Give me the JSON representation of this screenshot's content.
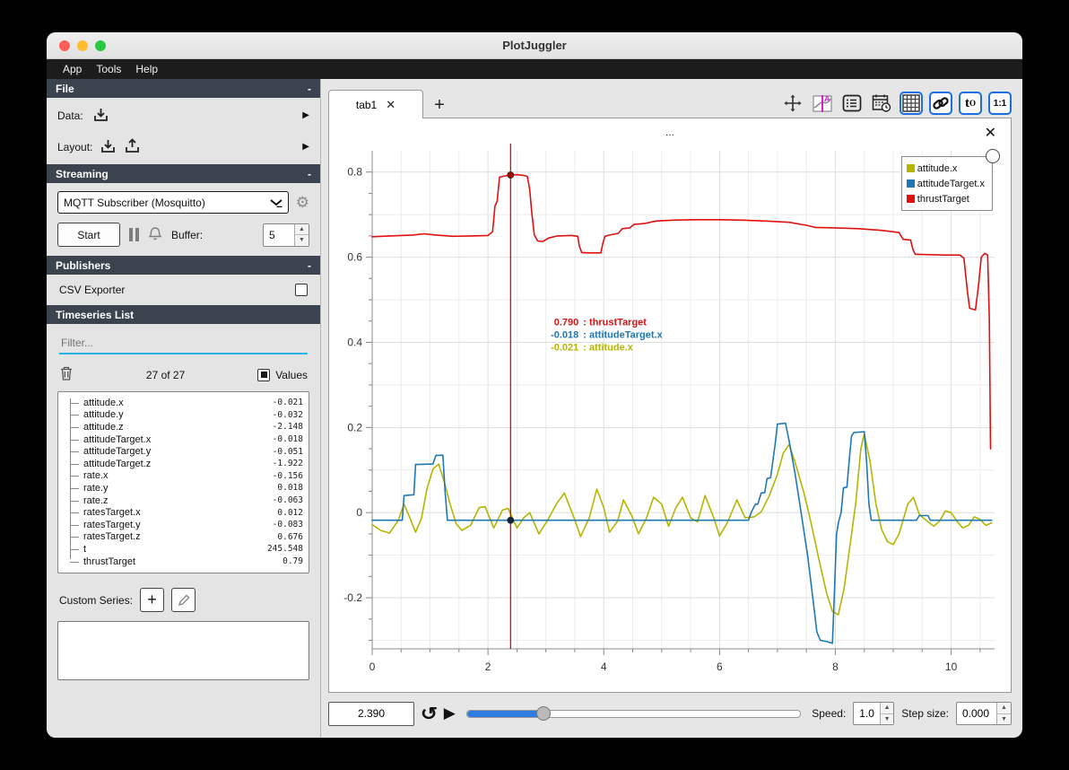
{
  "window": {
    "title": "PlotJuggler"
  },
  "menubar": {
    "items": [
      "App",
      "Tools",
      "Help"
    ]
  },
  "sidebar": {
    "file_section": {
      "title": "File",
      "collapse": "-",
      "data_label": "Data:",
      "layout_label": "Layout:"
    },
    "streaming_section": {
      "title": "Streaming",
      "collapse": "-",
      "source_selected": "MQTT Subscriber (Mosquitto)",
      "start_button": "Start",
      "buffer_label": "Buffer:",
      "buffer_value": "5"
    },
    "publishers_section": {
      "title": "Publishers",
      "collapse": "-",
      "csv_exporter_label": "CSV Exporter",
      "csv_exporter_checked": false
    },
    "timeseries_section": {
      "title": "Timeseries List",
      "filter_placeholder": "Filter...",
      "count_text": "27 of 27",
      "values_label": "Values",
      "items": [
        {
          "name": "attitude.x",
          "value": "-0.021"
        },
        {
          "name": "attitude.y",
          "value": "-0.032"
        },
        {
          "name": "attitude.z",
          "value": "-2.148"
        },
        {
          "name": "attitudeTarget.x",
          "value": "-0.018"
        },
        {
          "name": "attitudeTarget.y",
          "value": "-0.051"
        },
        {
          "name": "attitudeTarget.z",
          "value": "-1.922"
        },
        {
          "name": "rate.x",
          "value": "-0.156"
        },
        {
          "name": "rate.y",
          "value": "0.018"
        },
        {
          "name": "rate.z",
          "value": "-0.063"
        },
        {
          "name": "ratesTarget.x",
          "value": "0.012"
        },
        {
          "name": "ratesTarget.y",
          "value": "-0.083"
        },
        {
          "name": "ratesTarget.z",
          "value": "0.676"
        },
        {
          "name": "t",
          "value": "245.548"
        },
        {
          "name": "thrustTarget",
          "value": "0.79"
        }
      ]
    },
    "custom_series": {
      "label": "Custom Series:"
    }
  },
  "tabs": {
    "active": "tab1",
    "close": "✕",
    "add_button": "+"
  },
  "toolbar": {
    "icons": [
      "move-icon",
      "tracker-style-icon",
      "list-icon",
      "datetime-icon",
      "grid-layout-icon",
      "link-icon",
      "time-offset-icon",
      "ratio-1-1-icon"
    ],
    "active_color": "#1d6fe0"
  },
  "plot": {
    "title": "...",
    "close": "✕",
    "tooltip": {
      "lines": [
        {
          "value": "0.790",
          "series": "thrustTarget",
          "color": "#d31414"
        },
        {
          "value": "-0.018",
          "series": "attitudeTarget.x",
          "color": "#1f77b4"
        },
        {
          "value": "-0.021",
          "series": "attitude.x",
          "color": "#b5b500"
        }
      ]
    }
  },
  "chart_data": {
    "type": "line",
    "title": "...",
    "x_range": [
      0,
      10.75
    ],
    "y_range": [
      -0.32,
      0.85
    ],
    "x_ticks": [
      0,
      2,
      4,
      6,
      8,
      10
    ],
    "y_ticks": [
      -0.2,
      0,
      0.2,
      0.4,
      0.6,
      0.8
    ],
    "grid": true,
    "legend_position": "top-right",
    "tracker": {
      "x": 2.39,
      "points": [
        {
          "series": "thrustTarget",
          "y": 0.793,
          "color": "#b00000"
        },
        {
          "series": "attitudeTarget.x",
          "y": -0.018,
          "color": "#10243a"
        }
      ]
    },
    "series": [
      {
        "name": "attitude.x",
        "color": "#b5b500",
        "points": [
          [
            0,
            -0.028
          ],
          [
            0.15,
            -0.042
          ],
          [
            0.3,
            -0.048
          ],
          [
            0.45,
            -0.018
          ],
          [
            0.55,
            0.02
          ],
          [
            0.65,
            -0.012
          ],
          [
            0.75,
            -0.046
          ],
          [
            0.85,
            -0.014
          ],
          [
            0.95,
            0.058
          ],
          [
            1.05,
            0.102
          ],
          [
            1.15,
            0.114
          ],
          [
            1.25,
            0.07
          ],
          [
            1.35,
            0.018
          ],
          [
            1.45,
            -0.026
          ],
          [
            1.55,
            -0.042
          ],
          [
            1.7,
            -0.03
          ],
          [
            1.85,
            0.012
          ],
          [
            1.95,
            0.014
          ],
          [
            2.1,
            -0.036
          ],
          [
            2.25,
            0.006
          ],
          [
            2.35,
            0.01
          ],
          [
            2.5,
            -0.036
          ],
          [
            2.62,
            -0.012
          ],
          [
            2.72,
            0
          ],
          [
            2.88,
            -0.05
          ],
          [
            3.02,
            -0.02
          ],
          [
            3.18,
            0.02
          ],
          [
            3.32,
            0.046
          ],
          [
            3.48,
            -0.01
          ],
          [
            3.6,
            -0.056
          ],
          [
            3.75,
            -0.012
          ],
          [
            3.88,
            0.055
          ],
          [
            4,
            0.012
          ],
          [
            4.1,
            -0.046
          ],
          [
            4.24,
            -0.02
          ],
          [
            4.34,
            0.03
          ],
          [
            4.48,
            -0.006
          ],
          [
            4.6,
            -0.05
          ],
          [
            4.74,
            -0.012
          ],
          [
            4.86,
            0.036
          ],
          [
            5,
            0.02
          ],
          [
            5.12,
            -0.032
          ],
          [
            5.24,
            0.01
          ],
          [
            5.36,
            0.036
          ],
          [
            5.5,
            -0.012
          ],
          [
            5.62,
            -0.022
          ],
          [
            5.75,
            0.04
          ],
          [
            5.9,
            -0.012
          ],
          [
            6,
            -0.055
          ],
          [
            6.14,
            -0.022
          ],
          [
            6.3,
            0.03
          ],
          [
            6.44,
            -0.012
          ],
          [
            6.6,
            -0.01
          ],
          [
            6.72,
            0.002
          ],
          [
            6.86,
            0.04
          ],
          [
            7,
            0.09
          ],
          [
            7.1,
            0.14
          ],
          [
            7.2,
            0.16
          ],
          [
            7.3,
            0.12
          ],
          [
            7.45,
            0.05
          ],
          [
            7.56,
            -0.012
          ],
          [
            7.7,
            -0.1
          ],
          [
            7.85,
            -0.19
          ],
          [
            7.95,
            -0.232
          ],
          [
            8.05,
            -0.24
          ],
          [
            8.15,
            -0.18
          ],
          [
            8.25,
            -0.08
          ],
          [
            8.35,
            0.02
          ],
          [
            8.44,
            0.15
          ],
          [
            8.5,
            0.185
          ],
          [
            8.6,
            0.12
          ],
          [
            8.7,
            0.02
          ],
          [
            8.8,
            -0.04
          ],
          [
            8.9,
            -0.068
          ],
          [
            9,
            -0.075
          ],
          [
            9.1,
            -0.05
          ],
          [
            9.25,
            0.02
          ],
          [
            9.35,
            0.036
          ],
          [
            9.45,
            -0.004
          ],
          [
            9.55,
            -0.016
          ],
          [
            9.7,
            -0.032
          ],
          [
            9.8,
            -0.02
          ],
          [
            9.9,
            0.004
          ],
          [
            10,
            0
          ],
          [
            10.1,
            -0.02
          ],
          [
            10.2,
            -0.036
          ],
          [
            10.3,
            -0.03
          ],
          [
            10.4,
            -0.01
          ],
          [
            10.5,
            -0.016
          ],
          [
            10.6,
            -0.03
          ],
          [
            10.7,
            -0.024
          ]
        ]
      },
      {
        "name": "attitudeTarget.x",
        "color": "#1f77b4",
        "points": [
          [
            0,
            -0.018
          ],
          [
            0.52,
            -0.018
          ],
          [
            0.55,
            0.04
          ],
          [
            0.72,
            0.042
          ],
          [
            0.75,
            0.113
          ],
          [
            1.05,
            0.114
          ],
          [
            1.1,
            0.134
          ],
          [
            1.22,
            0.135
          ],
          [
            1.26,
            0.05
          ],
          [
            1.3,
            -0.018
          ],
          [
            2.5,
            -0.018
          ],
          [
            4,
            -0.018
          ],
          [
            5.5,
            -0.018
          ],
          [
            6.5,
            -0.018
          ],
          [
            6.55,
            0.002
          ],
          [
            6.62,
            0.02
          ],
          [
            6.66,
            0.02
          ],
          [
            6.72,
            0.046
          ],
          [
            6.78,
            0.047
          ],
          [
            6.82,
            0.08
          ],
          [
            6.88,
            0.082
          ],
          [
            6.92,
            0.12
          ],
          [
            6.96,
            0.16
          ],
          [
            7,
            0.208
          ],
          [
            7.14,
            0.21
          ],
          [
            7.2,
            0.17
          ],
          [
            7.3,
            0.095
          ],
          [
            7.42,
            -0.01
          ],
          [
            7.52,
            -0.1
          ],
          [
            7.62,
            -0.21
          ],
          [
            7.68,
            -0.28
          ],
          [
            7.74,
            -0.3
          ],
          [
            7.85,
            -0.303
          ],
          [
            7.95,
            -0.307
          ],
          [
            7.98,
            -0.2
          ],
          [
            8.02,
            -0.05
          ],
          [
            8.06,
            -0.02
          ],
          [
            8.1,
            0
          ],
          [
            8.14,
            0.058
          ],
          [
            8.2,
            0.06
          ],
          [
            8.24,
            0.125
          ],
          [
            8.28,
            0.18
          ],
          [
            8.32,
            0.188
          ],
          [
            8.5,
            0.19
          ],
          [
            8.54,
            0.12
          ],
          [
            8.58,
            0.02
          ],
          [
            8.62,
            -0.018
          ],
          [
            9.4,
            -0.018
          ],
          [
            9.45,
            -0.007
          ],
          [
            9.6,
            -0.007
          ],
          [
            9.64,
            -0.018
          ],
          [
            10.7,
            -0.018
          ]
        ]
      },
      {
        "name": "thrustTarget",
        "color": "#e01010",
        "points": [
          [
            0,
            0.648
          ],
          [
            0.3,
            0.65
          ],
          [
            0.7,
            0.652
          ],
          [
            0.9,
            0.655
          ],
          [
            1.1,
            0.652
          ],
          [
            1.4,
            0.649
          ],
          [
            1.7,
            0.65
          ],
          [
            2,
            0.651
          ],
          [
            2.08,
            0.66
          ],
          [
            2.12,
            0.72
          ],
          [
            2.16,
            0.732
          ],
          [
            2.2,
            0.788
          ],
          [
            2.3,
            0.791
          ],
          [
            2.39,
            0.793
          ],
          [
            2.5,
            0.794
          ],
          [
            2.62,
            0.792
          ],
          [
            2.68,
            0.79
          ],
          [
            2.72,
            0.76
          ],
          [
            2.76,
            0.7
          ],
          [
            2.8,
            0.652
          ],
          [
            2.86,
            0.638
          ],
          [
            2.95,
            0.637
          ],
          [
            3.05,
            0.645
          ],
          [
            3.2,
            0.65
          ],
          [
            3.45,
            0.651
          ],
          [
            3.55,
            0.649
          ],
          [
            3.58,
            0.625
          ],
          [
            3.62,
            0.611
          ],
          [
            3.75,
            0.61
          ],
          [
            3.95,
            0.61
          ],
          [
            3.98,
            0.63
          ],
          [
            4.02,
            0.649
          ],
          [
            4.1,
            0.652
          ],
          [
            4.25,
            0.656
          ],
          [
            4.32,
            0.667
          ],
          [
            4.45,
            0.669
          ],
          [
            4.52,
            0.677
          ],
          [
            4.7,
            0.679
          ],
          [
            4.9,
            0.685
          ],
          [
            5.2,
            0.687
          ],
          [
            5.6,
            0.688
          ],
          [
            6,
            0.688
          ],
          [
            6.4,
            0.687
          ],
          [
            6.8,
            0.685
          ],
          [
            7.2,
            0.682
          ],
          [
            7.5,
            0.675
          ],
          [
            7.65,
            0.67
          ],
          [
            8,
            0.669
          ],
          [
            8.4,
            0.667
          ],
          [
            8.8,
            0.663
          ],
          [
            9.1,
            0.658
          ],
          [
            9.17,
            0.642
          ],
          [
            9.3,
            0.64
          ],
          [
            9.34,
            0.618
          ],
          [
            9.38,
            0.607
          ],
          [
            9.6,
            0.606
          ],
          [
            9.9,
            0.605
          ],
          [
            10.15,
            0.605
          ],
          [
            10.22,
            0.598
          ],
          [
            10.28,
            0.52
          ],
          [
            10.32,
            0.48
          ],
          [
            10.42,
            0.476
          ],
          [
            10.47,
            0.53
          ],
          [
            10.52,
            0.6
          ],
          [
            10.58,
            0.609
          ],
          [
            10.63,
            0.605
          ],
          [
            10.66,
            0.45
          ],
          [
            10.68,
            0.15
          ]
        ]
      }
    ]
  },
  "playback": {
    "time_value": "2.390",
    "slider_fraction": 0.23,
    "speed_label": "Speed:",
    "speed_value": "1.0",
    "step_label": "Step size:",
    "step_value": "0.000"
  }
}
